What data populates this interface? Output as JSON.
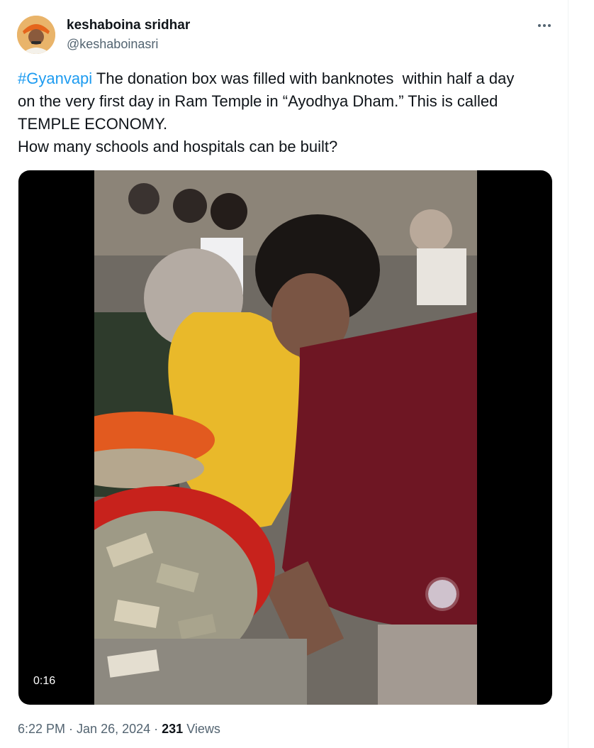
{
  "user": {
    "name": "keshaboina sridhar",
    "handle": "@keshaboinasri"
  },
  "tweet": {
    "hashtag": "#Gyanvapi",
    "line1_rest": " The donation box was filled with banknotes  within half a day",
    "line2": "on the very first day in Ram Temple in “Ayodhya Dham.” This is called",
    "line3": "TEMPLE ECONOMY.",
    "line4": "How many schools and hospitals can be built?"
  },
  "media": {
    "duration": "0:16"
  },
  "meta": {
    "time": "6:22 PM",
    "separator1": " · ",
    "date": "Jan 26, 2024",
    "separator2": " · ",
    "views_count": "231",
    "views_label": " Views"
  },
  "icons": {
    "more": "more-horizontal-icon"
  }
}
